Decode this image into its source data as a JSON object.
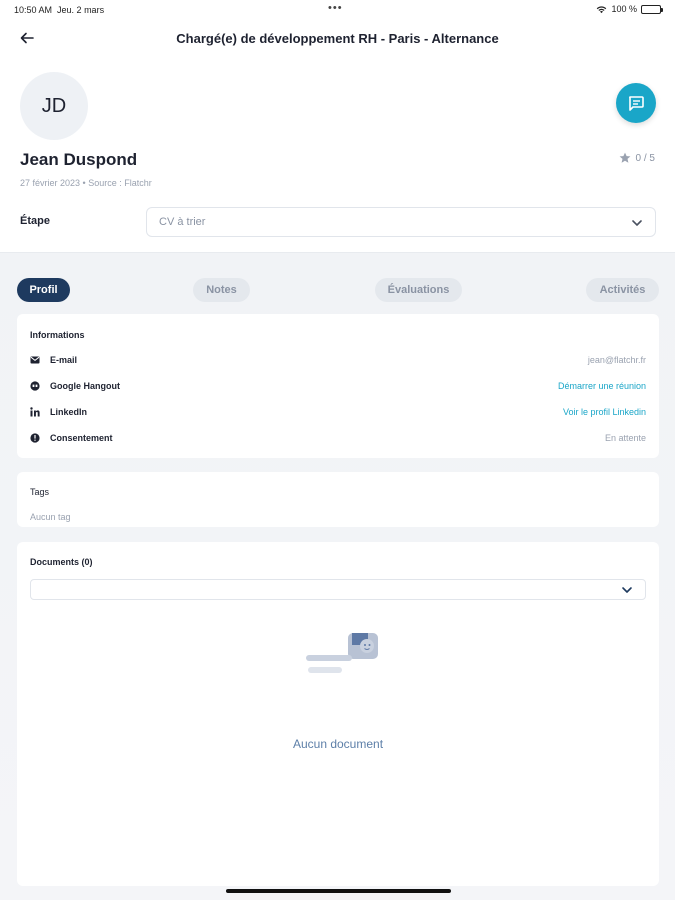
{
  "status": {
    "time": "10:50 AM",
    "date": "Jeu. 2 mars",
    "dots": "•••",
    "battery": "100 %"
  },
  "nav": {
    "title": "Chargé(e) de développement RH - Paris - Alternance",
    "back_icon": "arrow-left-icon"
  },
  "candidate": {
    "initials": "JD",
    "name": "Jean Duspond",
    "meta": "27 février 2023 • Source : Flatchr",
    "rating": "0 / 5"
  },
  "stage": {
    "label": "Étape",
    "value": "CV à trier"
  },
  "tabs": [
    {
      "label": "Profil",
      "active": true
    },
    {
      "label": "Notes",
      "active": false
    },
    {
      "label": "Évaluations",
      "active": false
    },
    {
      "label": "Activités",
      "active": false
    }
  ],
  "informations": {
    "title": "Informations",
    "rows": [
      {
        "icon": "mail-icon",
        "label": "E-mail",
        "value": "jean@flatchr.fr"
      },
      {
        "icon": "hangout-icon",
        "label": "Google Hangout",
        "value": "Démarrer une réunion"
      },
      {
        "icon": "linkedin-icon",
        "label": "LinkedIn",
        "value": "Voir le profil Linkedin"
      },
      {
        "icon": "info-icon",
        "label": "Consentement",
        "value": "En attente"
      }
    ]
  },
  "tags": {
    "title": "Tags",
    "empty": "Aucun tag"
  },
  "documents": {
    "title": "Documents (0)",
    "empty": "Aucun document"
  },
  "colors": {
    "accent": "#1aa6c8",
    "active_tab": "#1e3a5f",
    "muted": "#9aa2b0",
    "empty_text": "#5d7fa8"
  }
}
